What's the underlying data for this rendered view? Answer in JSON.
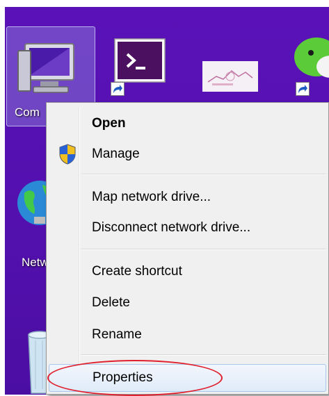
{
  "desktop": {
    "background_color": "#5310ae",
    "icons": [
      {
        "label": "Com",
        "icon": "computer-monitor-icon"
      },
      {
        "label": "",
        "icon": "terminal-icon"
      },
      {
        "label": "",
        "icon": "thumbnail-image-icon"
      },
      {
        "label": "",
        "icon": "chat-app-icon"
      },
      {
        "label": "Netw",
        "icon": "network-globe-icon"
      },
      {
        "label": "",
        "icon": "recycle-bin-icon"
      }
    ]
  },
  "context_menu": {
    "items": [
      {
        "label": "Open",
        "bold": true
      },
      {
        "label": "Manage",
        "icon": "uac-shield-icon"
      },
      {
        "label": "Map network drive..."
      },
      {
        "label": "Disconnect network drive..."
      },
      {
        "label": "Create shortcut"
      },
      {
        "label": "Delete"
      },
      {
        "label": "Rename"
      },
      {
        "label": "Properties",
        "highlighted": true
      }
    ],
    "highlight_color": "#e0202e"
  }
}
